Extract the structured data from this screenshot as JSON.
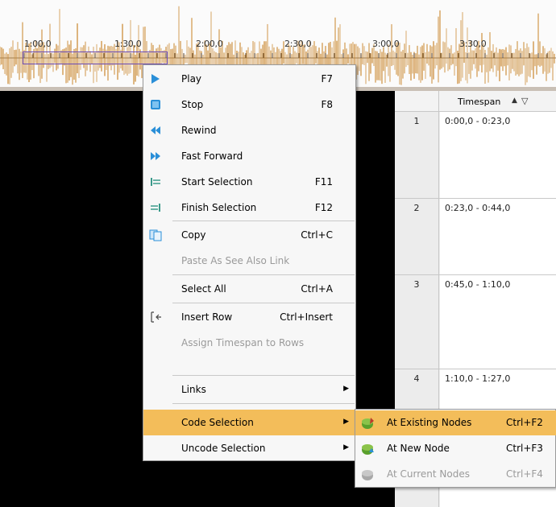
{
  "timeline": {
    "ticks": [
      "1:00,0",
      "1:30,0",
      "2:00,0",
      "2:30,0",
      "3:00,0",
      "3:30,0"
    ],
    "waveform_color": "#c9852a"
  },
  "grid": {
    "column_header": "Timespan",
    "rows": [
      {
        "num": "1",
        "timespan": "0:00,0 - 0:23,0"
      },
      {
        "num": "2",
        "timespan": "0:23,0 - 0:44,0"
      },
      {
        "num": "3",
        "timespan": "0:45,0 - 1:10,0"
      },
      {
        "num": "4",
        "timespan": "1:10,0 - 1:27,0"
      }
    ]
  },
  "menu": {
    "items": [
      {
        "label": "Play",
        "shortcut": "F7",
        "icon": "play-icon"
      },
      {
        "label": "Stop",
        "shortcut": "F8",
        "icon": "stop-icon"
      },
      {
        "label": "Rewind",
        "shortcut": "",
        "icon": "rewind-icon"
      },
      {
        "label": "Fast Forward",
        "shortcut": "",
        "icon": "fast-forward-icon"
      },
      {
        "label": "Start Selection",
        "shortcut": "F11",
        "icon": "start-selection-icon"
      },
      {
        "label": "Finish Selection",
        "shortcut": "F12",
        "icon": "finish-selection-icon"
      },
      {
        "label": "Copy",
        "shortcut": "Ctrl+C",
        "icon": "copy-icon"
      },
      {
        "label": "Paste As See Also Link",
        "shortcut": "",
        "icon": ""
      },
      {
        "label": "Select All",
        "shortcut": "Ctrl+A",
        "icon": ""
      },
      {
        "label": "Insert Row",
        "shortcut": "Ctrl+Insert",
        "icon": "insert-row-icon"
      },
      {
        "label": "Assign Timespan to Rows",
        "shortcut": "",
        "icon": ""
      },
      {
        "label": "Links",
        "shortcut": "",
        "icon": ""
      },
      {
        "label": "Code Selection",
        "shortcut": "",
        "icon": ""
      },
      {
        "label": "Uncode Selection",
        "shortcut": "",
        "icon": ""
      }
    ]
  },
  "submenu": {
    "items": [
      {
        "label": "At Existing Nodes",
        "shortcut": "Ctrl+F2",
        "icon": "existing-nodes-icon"
      },
      {
        "label": "At New Node",
        "shortcut": "Ctrl+F3",
        "icon": "new-node-icon"
      },
      {
        "label": "At Current Nodes",
        "shortcut": "Ctrl+F4",
        "icon": "current-nodes-icon"
      }
    ]
  },
  "colors": {
    "highlight": "#f3bd5a",
    "icon_blue": "#2a8fd8",
    "selection_border": "#6b4bb6"
  }
}
